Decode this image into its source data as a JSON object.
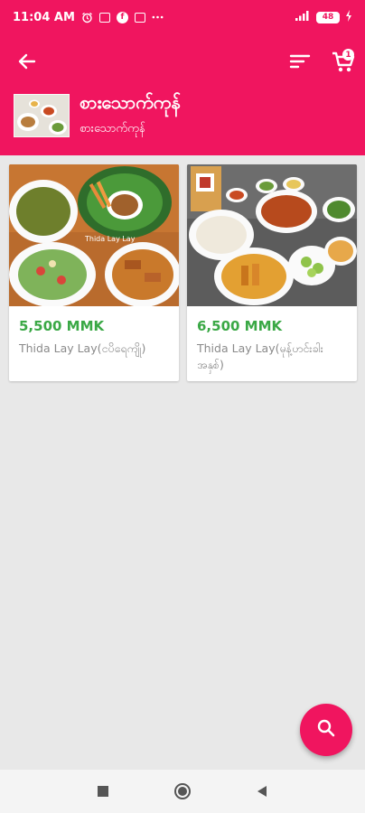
{
  "status_bar": {
    "time": "11:04 AM",
    "icons": [
      "alarm-icon",
      "message-icon",
      "facebook-icon",
      "app-icon",
      "more-icon"
    ],
    "right_icons": [
      "signal-icon",
      "battery-icon",
      "charging-icon"
    ],
    "battery": "48"
  },
  "app_bar": {
    "back_icon": "arrow-left-icon",
    "sort_icon": "sort-icon",
    "cart_icon": "cart-icon",
    "cart_count": "1",
    "background_color": "#f0155f"
  },
  "shop": {
    "title": "စားသောက်ကုန်",
    "subtitle": "စားသောက်ကုန်"
  },
  "products": [
    {
      "price": "5,500 MMK",
      "name": "Thida Lay Lay(ငပိရေကျို)",
      "watermark": "Thida Lay Lay"
    },
    {
      "price": "6,500 MMK",
      "name": "Thida Lay Lay(မုန့်ဟင်းခါး အနှစ်)"
    }
  ],
  "fab": {
    "icon": "search-icon",
    "color": "#f0155f"
  },
  "price_color": "#3aa845",
  "nav_bar": {
    "icons": [
      "recents-icon",
      "home-icon",
      "back-icon"
    ]
  }
}
